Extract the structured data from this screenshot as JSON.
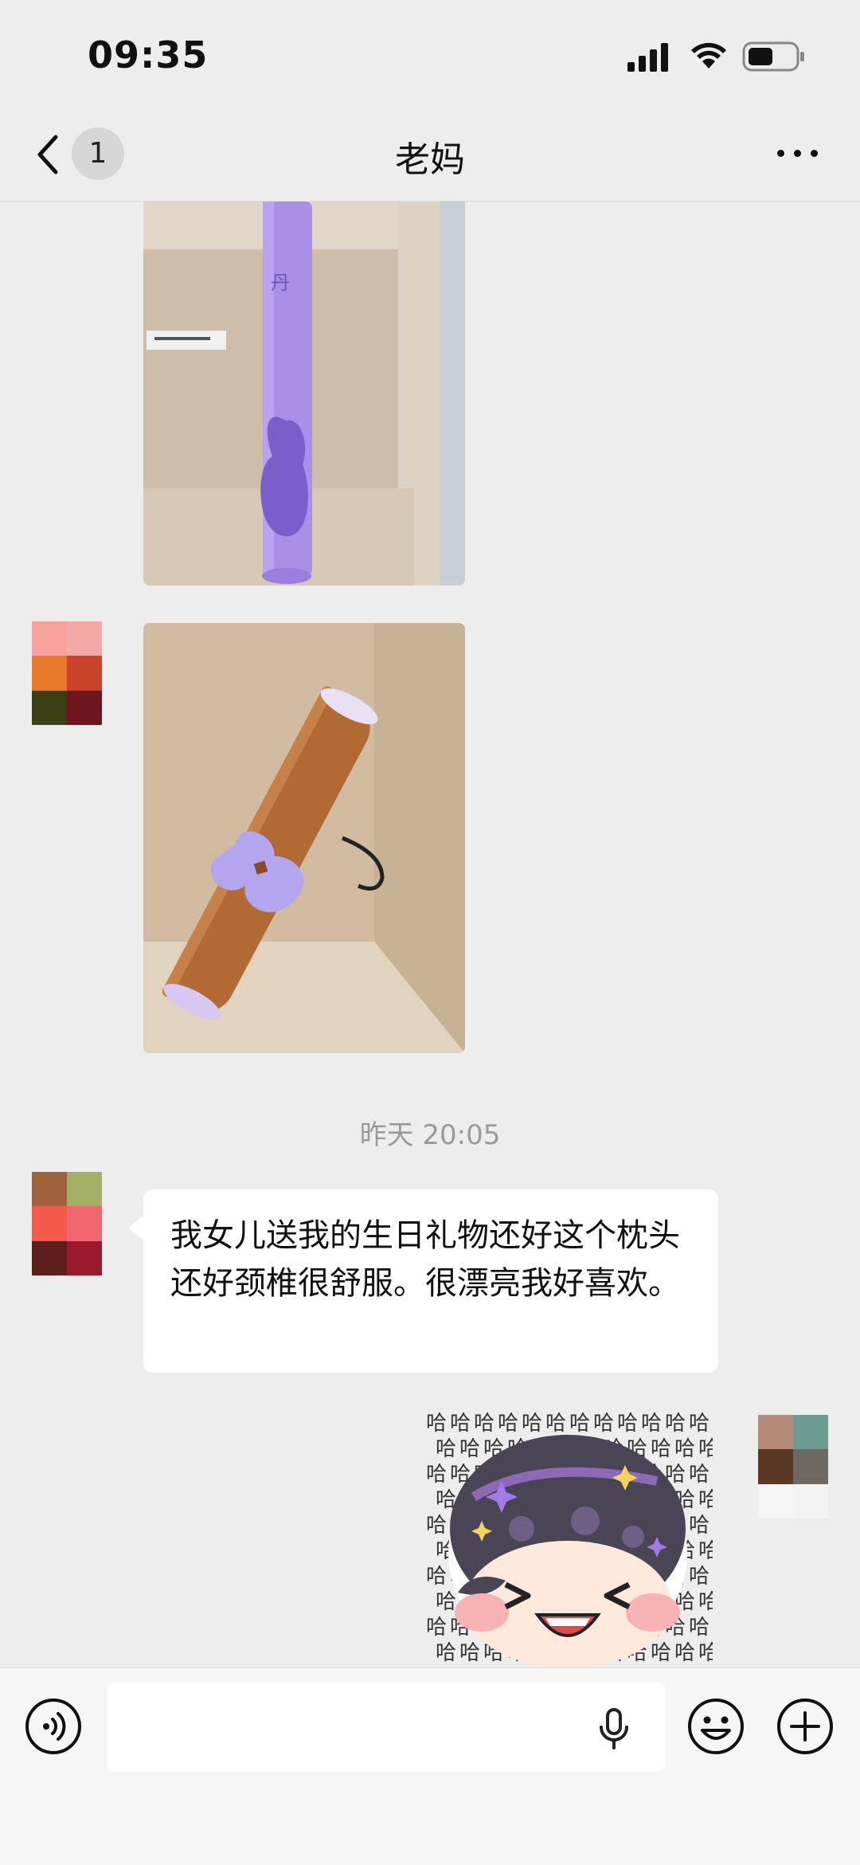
{
  "status_bar": {
    "time": "09:35"
  },
  "nav": {
    "unread_count": "1",
    "title": "老妈"
  },
  "chat": {
    "timestamp": "昨天 20:05",
    "text_message": "我女儿送我的生日礼物还好这个枕头还好颈椎很舒服。很漂亮我好喜欢。",
    "avatar_colors": {
      "top_partial": [
        "#8f1f1c",
        "#b3322c"
      ],
      "mom_1": [
        "#f7a09c",
        "#f3a9a6",
        "#e87b2a",
        "#c8432a",
        "#3a3f14",
        "#6d1620"
      ],
      "mom_2": [
        "#a0633e",
        "#a4b066",
        "#f25b4a",
        "#f1656e",
        "#5e1f1c",
        "#9b1a2a"
      ],
      "self": [
        "#b48b79",
        "#6d9a91",
        "#5a3826",
        "#6e6a62",
        "#f5f5f5",
        "#f3f3f3"
      ]
    }
  },
  "input": {
    "placeholder": ""
  },
  "colors": {
    "background": "#ededed",
    "bubble": "#ffffff",
    "timestamp_text": "#9a9a9a"
  }
}
